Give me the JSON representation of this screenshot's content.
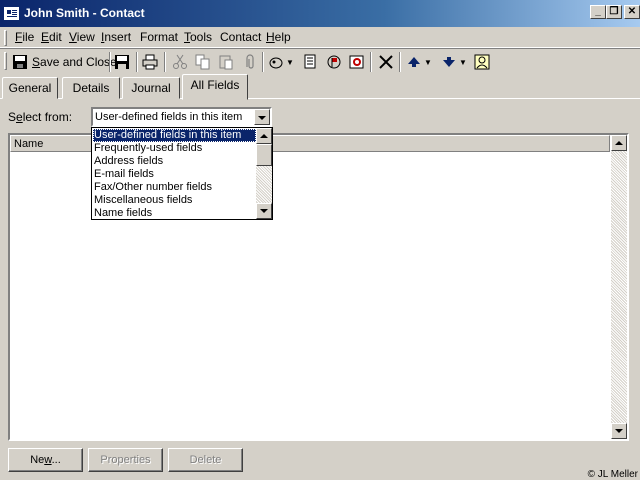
{
  "window": {
    "title": "John Smith - Contact",
    "controls": {
      "minimize": "_",
      "restore": "❐",
      "close": "✕"
    }
  },
  "menu": {
    "items": [
      {
        "key": "F",
        "rest": "ile"
      },
      {
        "key": "E",
        "rest": "dit"
      },
      {
        "key": "V",
        "rest": "iew"
      },
      {
        "key": "I",
        "rest": "nsert"
      },
      {
        "key": "",
        "rest": "Format"
      },
      {
        "key": "T",
        "rest": "ools"
      },
      {
        "key": "",
        "rest": "Contact"
      },
      {
        "key": "H",
        "rest": "elp"
      }
    ]
  },
  "toolbar": {
    "save_close_label": "Save and Close",
    "save_close_key": "S",
    "icons": [
      "save-close-icon",
      "save-icon",
      "print-icon",
      "cut-icon",
      "copy-icon",
      "paste-icon",
      "attach-icon",
      "action-icon",
      "properties-icon",
      "flag-icon",
      "map-icon",
      "delete-icon",
      "previous-item-icon",
      "next-item-icon",
      "address-book-icon"
    ]
  },
  "tabs": [
    "General",
    "Details",
    "Journal",
    "All Fields"
  ],
  "active_tab": "All Fields",
  "select_from": {
    "label_key": "e",
    "label_pre": "S",
    "label_post": "lect from:",
    "value": "User-defined fields in this item",
    "options": [
      "User-defined fields in this item",
      "Frequently-used fields",
      "Address fields",
      "E-mail fields",
      "Fax/Other number fields",
      "Miscellaneous fields",
      "Name fields"
    ],
    "selected_index": 0
  },
  "list": {
    "column_name": "Name"
  },
  "buttons": {
    "new_label": "New...",
    "new_key": "w",
    "properties_label": "Properties",
    "delete_label": "Delete"
  },
  "copyright": "© JL Meller",
  "colors": {
    "titlebar_start": "#0a246a",
    "titlebar_end": "#a6caf0",
    "selection": "#0a246a",
    "face": "#d4d0c8"
  }
}
